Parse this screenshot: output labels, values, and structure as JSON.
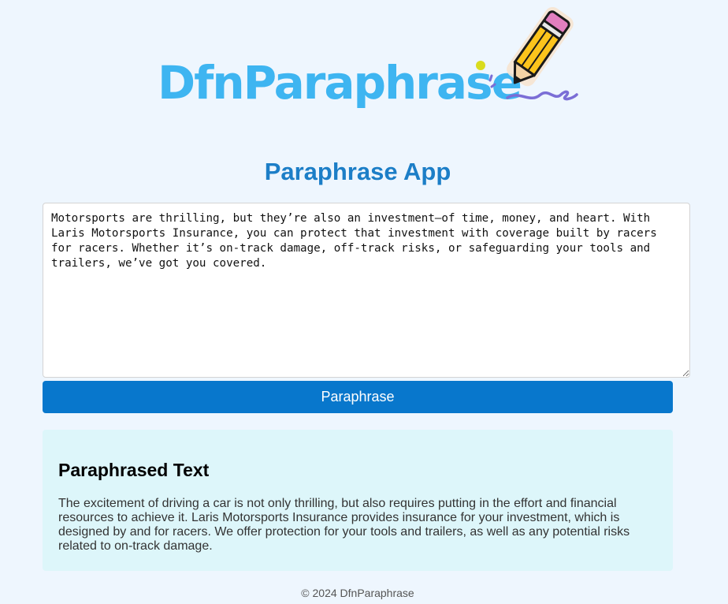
{
  "logo": {
    "text": "DfnParaphrase"
  },
  "app": {
    "title": "Paraphrase App"
  },
  "input": {
    "value": "Motorsports are thrilling, but they’re also an investment—of time, money, and heart. With Laris Motorsports Insurance, you can protect that investment with coverage built by racers for racers. Whether it’s on-track damage, off-track risks, or safeguarding your tools and trailers, we’ve got you covered."
  },
  "actions": {
    "paraphrase_label": "Paraphrase"
  },
  "result": {
    "heading": "Paraphrased Text",
    "text": "The excitement of driving a car is not only thrilling, but also requires putting in the effort and financial resources to achieve it. Laris Motorsports Insurance provides insurance for your investment, which is designed by and for racers. We offer protection for your tools and trailers, as well as any potential risks related to on-track damage."
  },
  "footer": {
    "copyright": "© 2024 DfnParaphrase"
  },
  "colors": {
    "background": "#eef6fe",
    "logo_blue": "#3eb5f1",
    "title_blue": "#1c7ec7",
    "button_blue": "#0877cc",
    "result_bg": "#ddf6fa",
    "pencil_yellow": "#fcc41c",
    "eraser_pink": "#e27fbf",
    "scribble_purple": "#7b6ed6",
    "dot_yellow": "#d9dc1e"
  },
  "icons": {
    "logo_pencil": "pencil-icon"
  }
}
